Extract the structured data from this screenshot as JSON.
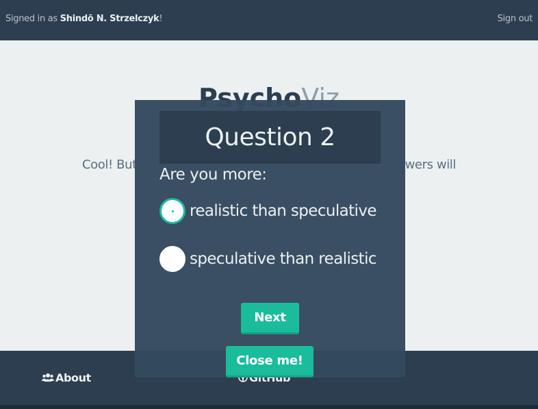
{
  "topbar": {
    "signed_in_prefix": "Signed in as ",
    "user_name": "Shindō N. Strzelczyk",
    "signed_in_suffix": "!",
    "sign_out_label": "Sign out"
  },
  "brand": {
    "bold": "Psycho",
    "light": "Viz"
  },
  "intro": {
    "left_text": "Cool! But",
    "right_text": "wers will"
  },
  "modal": {
    "question_title": "Question 2",
    "prompt": "Are you more:",
    "options": [
      {
        "label": "realistic than speculative",
        "checked": true
      },
      {
        "label": "speculative than realistic",
        "checked": false
      }
    ],
    "next_label": "Next",
    "close_label": "Close me!"
  },
  "footer": {
    "about_label": "About",
    "about_icon": "users-icon",
    "github_label": "GitHub",
    "github_icon": "github-icon"
  },
  "colors": {
    "navbar": "#2c3e50",
    "accent": "#1abc9c",
    "modal": "#34495e",
    "background": "#ecf0f1"
  }
}
